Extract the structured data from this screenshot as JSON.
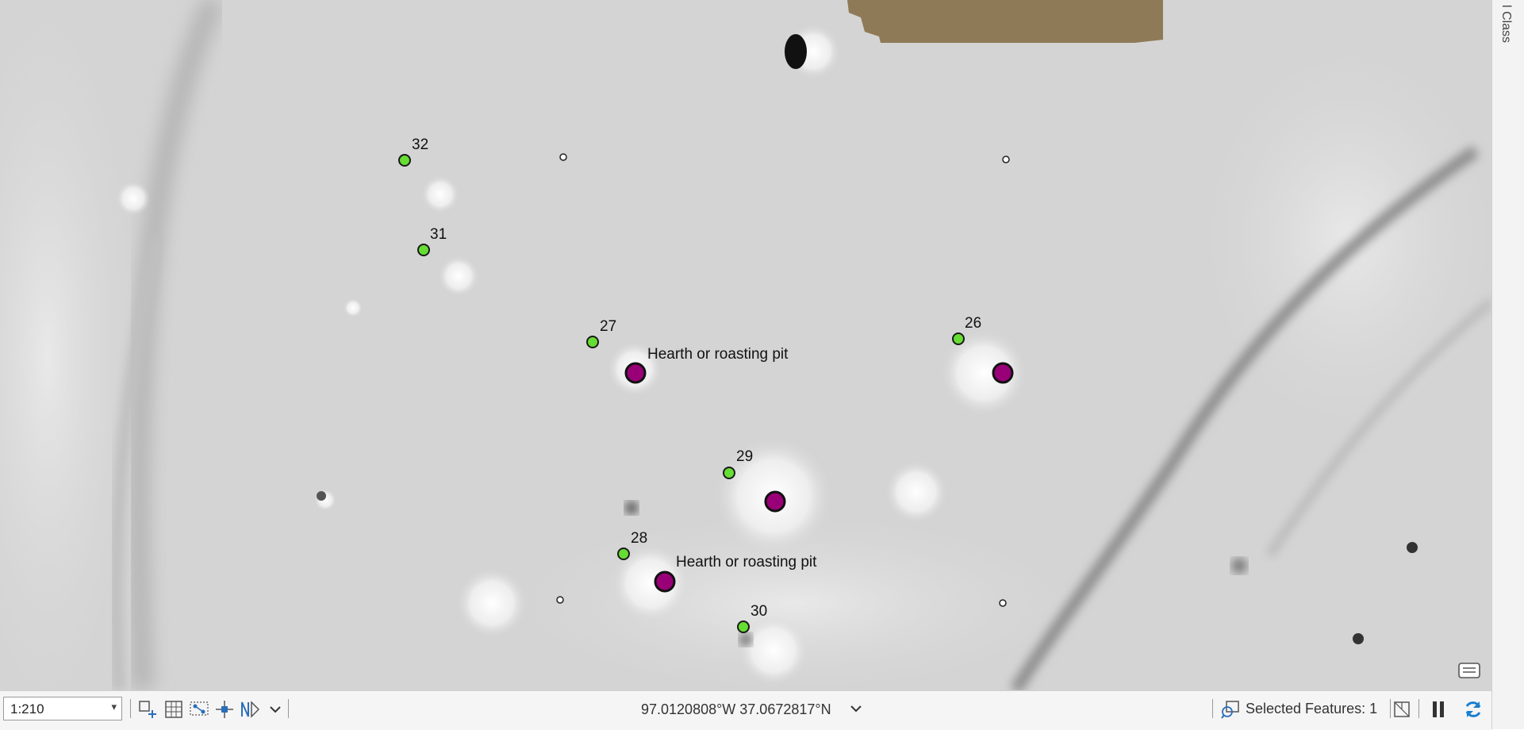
{
  "map": {
    "labels": {
      "n32": "32",
      "n31": "31",
      "n27": "27",
      "n26": "26",
      "n29": "29",
      "n28": "28",
      "n30": "30",
      "hearth_a": "Hearth or roasting pit",
      "hearth_b": "Hearth or roasting pit"
    },
    "colors": {
      "point_green": "#66dd33",
      "point_magenta": "#990077",
      "basemap": "#d6d6d6",
      "patch": "#8f7a58"
    }
  },
  "right_panel": {
    "text": "l Class"
  },
  "statusbar": {
    "scale": "1:210",
    "coordinates": "97.0120808°W 37.0672817°N",
    "selected_features": "Selected Features: 1",
    "icons": [
      "add-layer-icon",
      "grid-icon",
      "snapping-icon",
      "crosshair-icon",
      "north-arrow-icon",
      "chevron-down-icon",
      "selection-icon",
      "table-icon",
      "pause-icon",
      "refresh-icon",
      "notes-icon"
    ]
  }
}
